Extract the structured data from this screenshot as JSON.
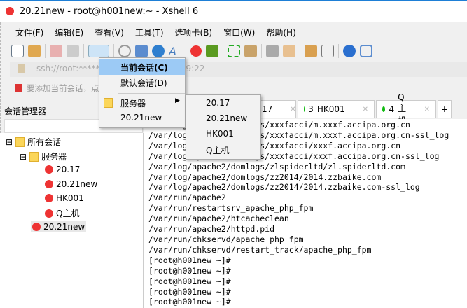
{
  "window": {
    "title": "20.21new - root@h001new:~ - Xshell 6"
  },
  "menubar": [
    "文件(F)",
    "编辑(E)",
    "查看(V)",
    "工具(T)",
    "选项卡(B)",
    "窗口(W)",
    "帮助(H)"
  ],
  "address": {
    "value": "ssh://root:*******",
    "suffix": "7.9:22"
  },
  "bookmark_hint": "要添加当前会话，点",
  "session_manager": {
    "title": "会话管理器",
    "tree": [
      "所有会话",
      "服务器",
      "20.17",
      "20.21new",
      "HK001",
      "Q主机",
      "20.21new"
    ]
  },
  "tabs": [
    {
      "label": "17"
    },
    {
      "num": "3",
      "label": "HK001"
    },
    {
      "num": "4",
      "label": "Q主机"
    }
  ],
  "tab_add": "+",
  "dropdown": {
    "items": [
      "当前会话(C)",
      "默认会话(D)",
      "服务器",
      "20.21new"
    ]
  },
  "submenu": {
    "items": [
      "20.17",
      "20.21new",
      "HK001",
      "Q主机"
    ]
  },
  "terminal": {
    "lines": [
      "/var/log/apache2/domlogs/xxxfacci/m.xxxf.accipa.org.cn",
      "/var/log/apache2/domlogs/xxxfacci/m.xxxf.accipa.org.cn-ssl_log",
      "/var/log/apache2/domlogs/xxxfacci/xxxf.accipa.org.cn",
      "/var/log/apache2/domlogs/xxxfacci/xxxf.accipa.org.cn-ssl_log",
      "/var/log/apache2/domlogs/zlspiderltd/zl.spiderltd.com",
      "/var/log/apache2/domlogs/zz2014/2014.zzbaike.com",
      "/var/log/apache2/domlogs/zz2014/2014.zzbaike.com-ssl_log",
      "/var/run/apache2",
      "/var/run/restartsrv_apache_php_fpm",
      "/var/run/apache2/htcacheclean",
      "/var/run/apache2/httpd.pid",
      "/var/run/chkservd/apache_php_fpm",
      "/var/run/chkservd/restart_track/apache_php_fpm",
      "[root@h001new ~]#",
      "[root@h001new ~]#",
      "[root@h001new ~]#",
      "[root@h001new ~]#",
      "[root@h001new ~]#"
    ]
  }
}
